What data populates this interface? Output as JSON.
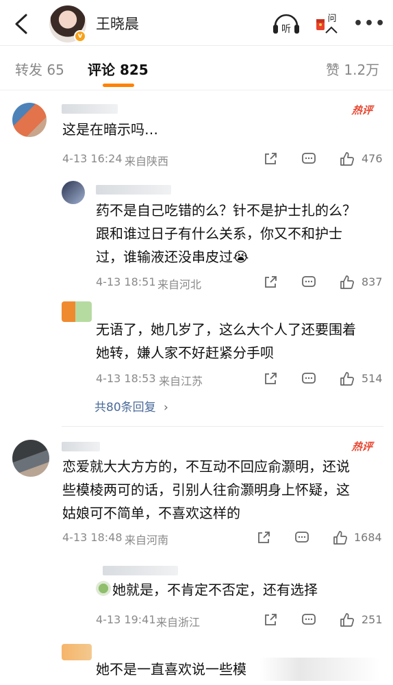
{
  "header": {
    "user_name": "王晓晨",
    "listen_label": "听",
    "ask_label": "问"
  },
  "tabs": [
    {
      "label": "转发 65"
    },
    {
      "label": "评论 825"
    },
    {
      "label": "赞 1.2万"
    }
  ],
  "comments": [
    {
      "text": "这是在暗示吗…",
      "time": "4-13 16:24",
      "location": "来自陕西",
      "likes": "476",
      "hot_label": "热评",
      "replies": [
        {
          "lines": [
            "药不是自己吃错的么？针不是护士扎的么？",
            "跟和谁过日子有什么关系，你又不和护士",
            "过，谁输液还没串皮过😭"
          ],
          "time": "4-13 18:51",
          "location": "来自河北",
          "likes": "837"
        },
        {
          "lines": [
            "无语了，她几岁了，这么大个人了还要围着",
            "她转，嫌人家不好赶紧分手呗"
          ],
          "time": "4-13 18:53",
          "location": "来自江苏",
          "likes": "514"
        }
      ],
      "more_replies": "共80条回复"
    },
    {
      "lines": [
        "恋爱就大大方方的，不互动不回应俞灏明，还说",
        "些模棱两可的话，引别人往俞灏明身上怀疑，这",
        "姑娘可不简单，不喜欢这样的"
      ],
      "time": "4-13 18:48",
      "location": "来自河南",
      "likes": "1684",
      "hot_label": "热评",
      "replies": [
        {
          "lines": [
            "她就是，不肯定不否定，还有选择"
          ],
          "time": "4-13 19:41",
          "location": "来自浙江",
          "likes": "251"
        },
        {
          "lines": [
            "她不是一直喜欢说一些模"
          ]
        }
      ]
    }
  ],
  "colors": {
    "accent": "#ff8200",
    "hot": "#e8452f",
    "link": "#4a6a99",
    "meta": "#8a8a8a"
  }
}
